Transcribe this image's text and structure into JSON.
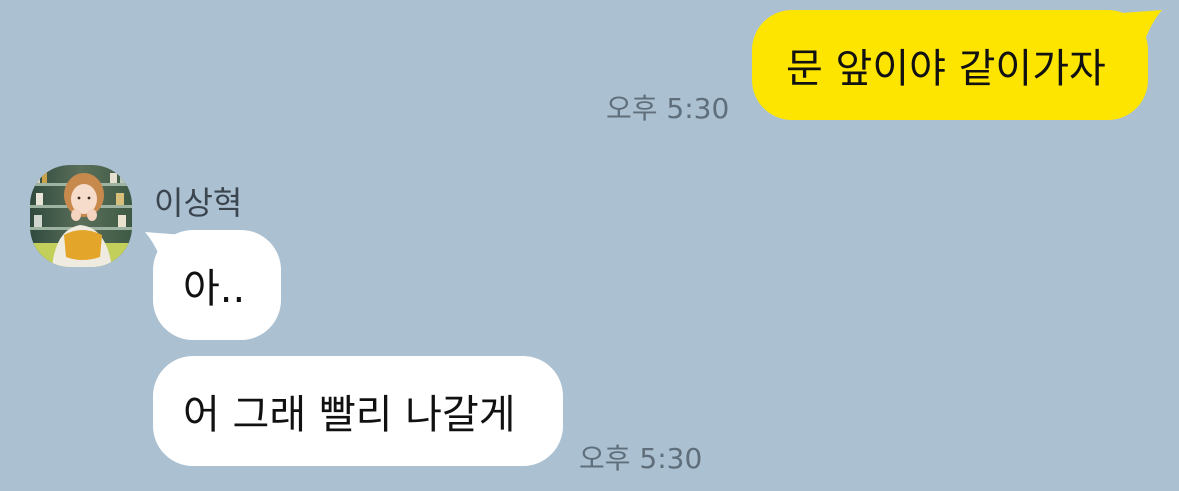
{
  "chat": {
    "background_color": "#abc1d1",
    "outgoing_bubble_color": "#fee500",
    "incoming_bubble_color": "#ffffff",
    "messages": [
      {
        "direction": "outgoing",
        "text": "문 앞이야 같이가자",
        "time": "오후 5:30"
      },
      {
        "direction": "incoming",
        "sender": "이상혁",
        "avatar_icon": "profile-photo",
        "text": "아.."
      },
      {
        "direction": "incoming",
        "text": "어 그래 빨리 나갈게",
        "time": "오후 5:30"
      }
    ]
  }
}
